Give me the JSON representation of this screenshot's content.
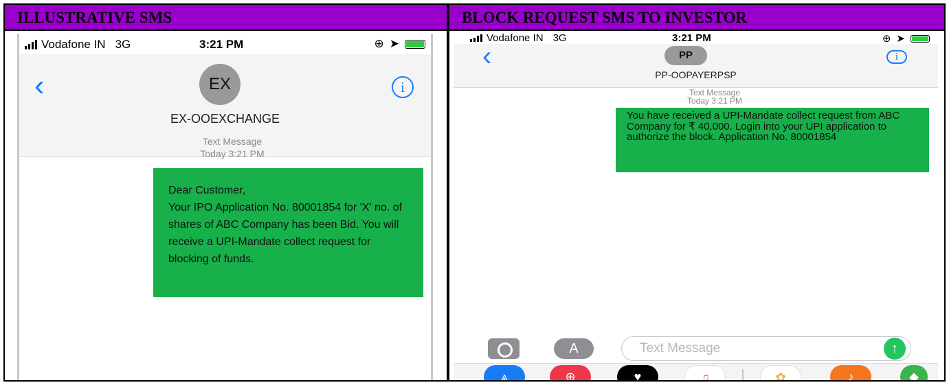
{
  "headers": {
    "left": "ILLUSTRATIVE SMS",
    "right": "BLOCK REQUEST SMS TO INVESTOR"
  },
  "left_phone": {
    "status": {
      "carrier": "Vodafone IN",
      "network": "3G",
      "time": "3:21 PM"
    },
    "back_icon": "chevron-left",
    "info_icon": "i",
    "avatar_initials": "EX",
    "contact_name": "EX-OOEXCHANGE",
    "meta": {
      "type": "Text Message",
      "time": "Today 3:21 PM"
    },
    "message": "Dear Customer,\nYour IPO Application No. 80001854 for 'X' no. of shares of ABC Company has been Bid. You will receive a UPI-Mandate collect request for blocking of funds."
  },
  "right_phone": {
    "status": {
      "carrier": "Vodafone IN",
      "network": "3G",
      "time": "3:21 PM"
    },
    "back_icon": "chevron-left",
    "info_icon": "i",
    "avatar_initials": "PP",
    "contact_name": "PP-OOPAYERPSP",
    "meta": {
      "type": "Text Message",
      "time": "Today 3:21 PM"
    },
    "message": "You have received a UPI-Mandate collect request from ABC Company for ₹ 40,000. Login into your UPI application to authorize the block. Application No. 80001854",
    "composer": {
      "placeholder": "Text Message",
      "send_icon": "↑",
      "appstore_icon": "A"
    },
    "apps": [
      "app-store",
      "search-globe",
      "digital-touch",
      "music",
      "photos",
      "garageband",
      "maps"
    ]
  },
  "colors": {
    "header": "#9900cc",
    "bubble": "#17b04a",
    "ios_blue": "#1a7cf5"
  }
}
